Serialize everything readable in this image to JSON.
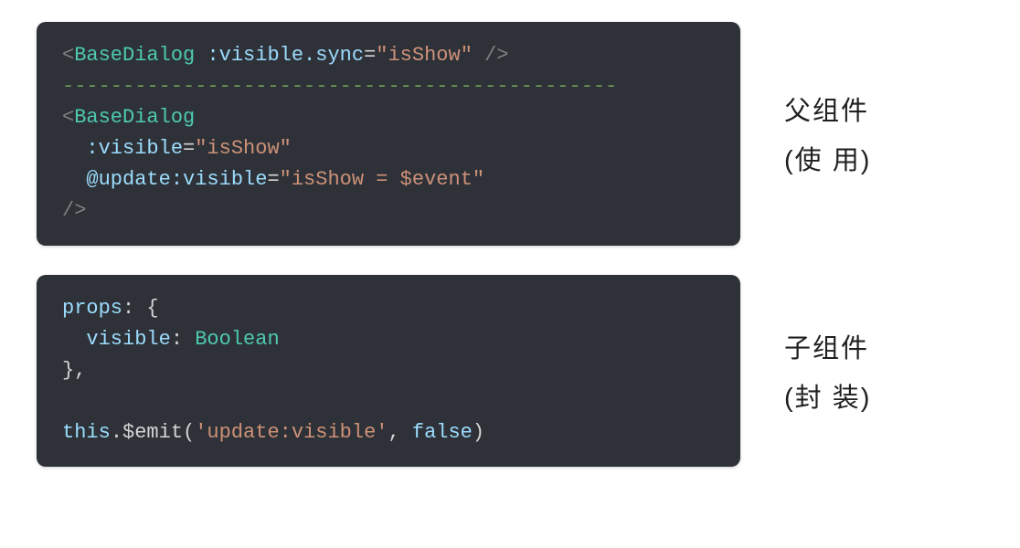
{
  "parent": {
    "tokens": {
      "openBracket": "<",
      "closeSelf": " />",
      "closeOpen": "/>",
      "tagName": "BaseDialog",
      "attrSync": ":visible.sync",
      "eq": "=",
      "valIsShow": "\"isShow\"",
      "dashes": "----------------------------------------------",
      "attrVisible": ":visible",
      "attrUpdate": "@update:visible",
      "valExpr": "\"isShow = $event\""
    },
    "labelTitle": "父组件",
    "labelParenOpen": "(使",
    "labelParenMid": "用)",
    "labelSub": "(使 用)"
  },
  "child": {
    "tokens": {
      "props": "props",
      "colon": ":",
      "openBrace": " {",
      "visibleKey": "visible",
      "boolType": "Boolean",
      "closeBrace": "}",
      "comma": ",",
      "thisKw": "this",
      "dot": ".",
      "emit": "$emit",
      "openParen": "(",
      "arg1": "'update:visible'",
      "sep": ", ",
      "arg2": "false",
      "closeParen": ")"
    },
    "labelTitle": "子组件",
    "labelSub": "(封 装)"
  }
}
